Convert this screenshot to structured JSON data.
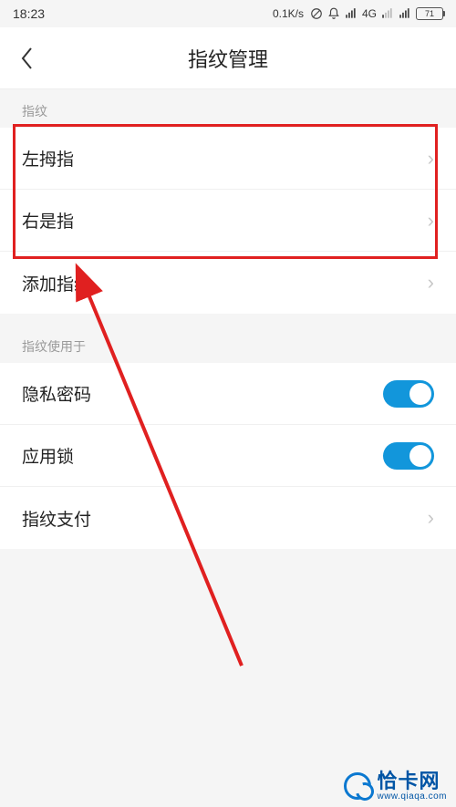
{
  "status": {
    "time": "18:23",
    "speed": "0.1K/s",
    "network_label": "4G",
    "battery_pct": "71"
  },
  "header": {
    "title": "指纹管理"
  },
  "section1": {
    "label": "指纹",
    "items": [
      {
        "label": "左拇指"
      },
      {
        "label": "右是指"
      },
      {
        "label": "添加指纹"
      }
    ]
  },
  "section2": {
    "label": "指纹使用于",
    "items": [
      {
        "label": "隐私密码",
        "type": "toggle",
        "on": true
      },
      {
        "label": "应用锁",
        "type": "toggle",
        "on": true
      },
      {
        "label": "指纹支付",
        "type": "chevron"
      }
    ]
  },
  "watermark": {
    "name": "恰卡网",
    "url": "www.qiaqa.com"
  }
}
